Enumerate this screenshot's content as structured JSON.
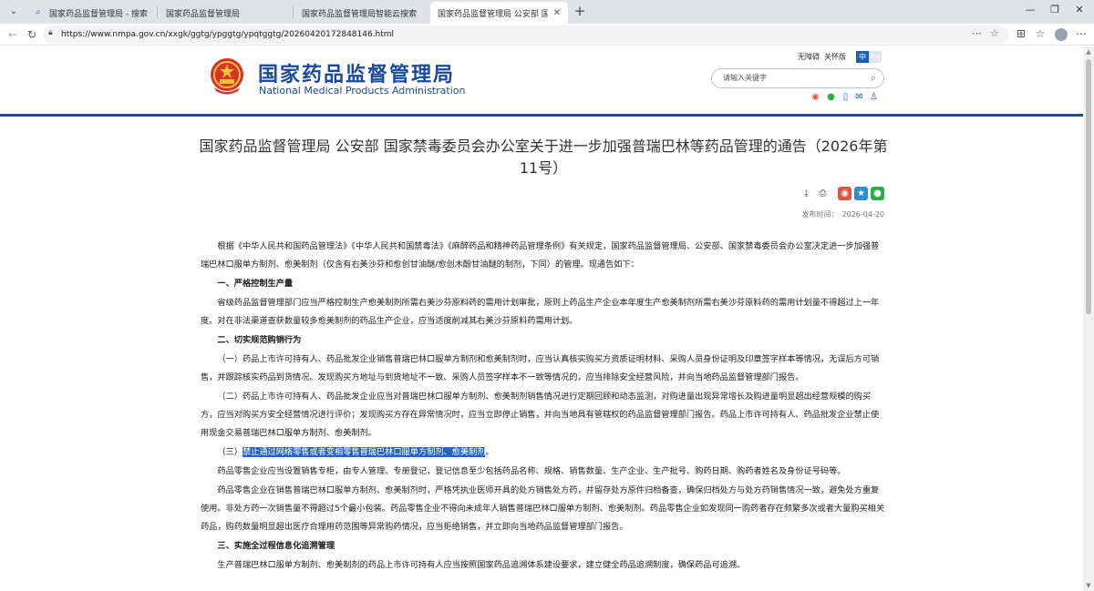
{
  "browser": {
    "tabs": [
      {
        "title": "国家药品监督管理局 - 搜索",
        "icon": "search-icon",
        "active": false
      },
      {
        "title": "国家药品监督管理局",
        "icon": "emblem-icon",
        "active": false
      },
      {
        "title": "国家药品监督管理局智能云搜索",
        "icon": "emblem-icon",
        "active": false
      },
      {
        "title": "国家药品监督管理局 公安部 国家禁",
        "icon": "emblem-icon",
        "active": true
      }
    ],
    "url": "https://www.nmpa.gov.cn/xxgk/ggtg/ypggtg/ypqtggtg/20260420172848146.html"
  },
  "header": {
    "site_name_cn": "国家药品监督管理局",
    "site_name_en": "National Medical Products Administration",
    "links": {
      "accessible": "无障碍",
      "elderly": "关怀版"
    },
    "lang": {
      "cn": "中",
      "en": "En"
    },
    "search_placeholder": "请输入关键字",
    "social_icons": [
      "weibo-icon",
      "wechat-icon",
      "mobile-icon",
      "mail-icon",
      "user-icon"
    ],
    "accent_color": "#1a4aa0"
  },
  "article": {
    "title": "国家药品监督管理局 公安部 国家禁毒委员会办公室关于进一步加强普瑞巴林等药品管理的通告（2026年第11号）",
    "publish_label": "发布时间：",
    "publish_date": "2026-04-20",
    "paragraphs": {
      "intro": "根据《中华人民共和国药品管理法》《中华人民共和国禁毒法》《麻醉药品和精神药品管理条例》有关规定，国家药品监督管理局、公安部、国家禁毒委员会办公室决定进一步加强普瑞巴林口服单方制剂、愈美制剂（仅含有右美沙芬和愈创甘油醚/愈创木酚甘油醚的制剂，下同）的管理。现通告如下：",
      "s1": "一、严格控制生产量",
      "s1_p1": "省级药品监督管理部门应当严格控制生产愈美制剂所需右美沙芬原料药的需用计划审批，原则上药品生产企业本年度生产愈美制剂所需右美沙芬原料药的需用计划量不得超过上一年度。对在非法渠道查获数量较多愈美制剂的药品生产企业，应当适度削减其右美沙芬原料药需用计划。",
      "s2": "二、切实规范购销行为",
      "s2_p1": "（一）药品上市许可持有人、药品批发企业销售普瑞巴林口服单方制剂和愈美制剂时，应当认真核实购买方资质证明材料、采购人员身份证明及印章签字样本等情况，无误后方可销售，并跟踪核实药品到货情况。发现购买方地址与到货地址不一致、采购人员签字样本不一致等情况的，应当排除安全经营风险，并向当地药品监督管理部门报告。",
      "s2_p2": "（二）药品上市许可持有人、药品批发企业应当对普瑞巴林口服单方制剂、愈美制剂销售情况进行定期回顾和动态监测，对购进量出现异常增长及购进量明显超出经营规模的购买方，应当对购买方安全经营情况进行评价；发现购买方存在异常情况时，应当立即停止销售，并向当地具有管辖权的药品监督管理部门报告。药品上市许可持有人、药品批发企业禁止使用现金交易普瑞巴林口服单方制剂、愈美制剂。",
      "s2_p3_prefix": "（三）",
      "s2_p3_highlight": "禁止通过网络零售或者变相零售普瑞巴林口服单方制剂、愈美制剂",
      "s2_p3_suffix": "。",
      "s2_p4": "药品零售企业应当设置销售专柜，由专人管理、专册登记，登记信息至少包括药品名称、规格、销售数量、生产企业、生产批号、购药日期、购药者姓名及身份证号码等。",
      "s2_p5": "药品零售企业在销售普瑞巴林口服单方制剂、愈美制剂时，严格凭执业医师开具的处方销售处方药，并留存处方原件归档备查，确保归档处方与处方药销售情况一致，避免处方重复使用。非处方药一次销售量不得超过5个最小包装。药品零售企业不得向未成年人销售普瑞巴林口服单方制剂、愈美制剂。药品零售企业如发现同一购药者存在频繁多次或者大量购买相关药品，购药数量明显超出医疗合理用药范围等异常购药情况，应当拒绝销售，并立即向当地药品监督管理部门报告。",
      "s3": "三、实施全过程信息化追溯管理",
      "s3_p1": "生产普瑞巴林口服单方制剂、愈美制剂的药品上市许可持有人应当按照国家药品追溯体系建设要求，建立健全药品追溯制度，确保药品可追溯。"
    },
    "highlight_color": "#2762c8"
  }
}
